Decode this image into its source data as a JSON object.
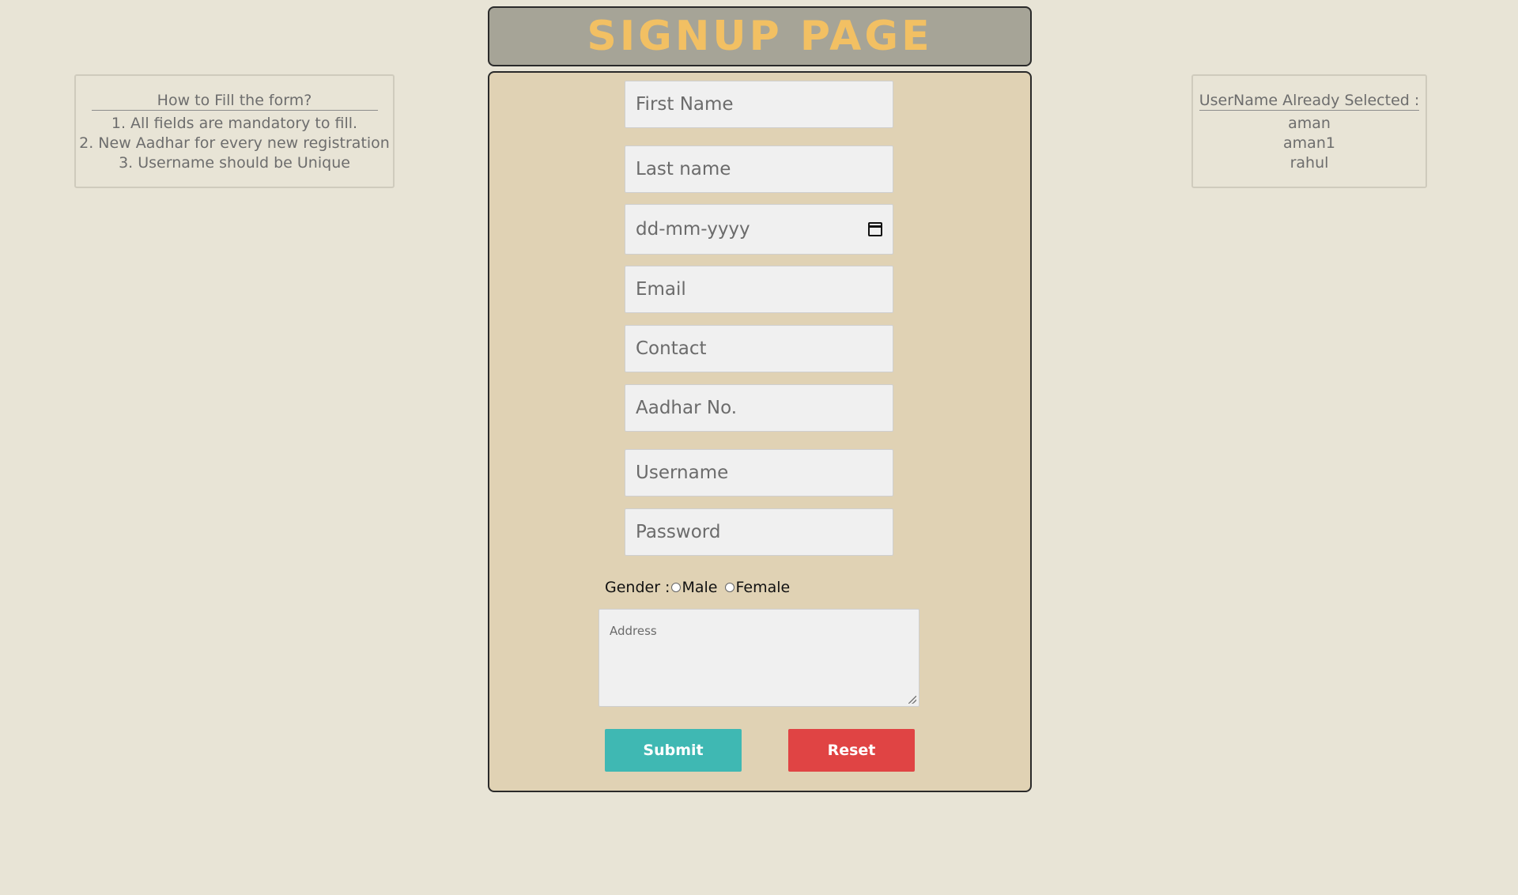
{
  "header": {
    "title": "SIGNUP PAGE"
  },
  "instructions": {
    "title": "How to Fill the form?",
    "items": [
      "1. All fields are mandatory to fill.",
      "2. New Aadhar for every new registration",
      "3. Username should be Unique"
    ]
  },
  "taken_usernames": {
    "title": "UserName Already Selected :",
    "items": [
      "aman",
      "aman1",
      "rahul"
    ]
  },
  "form": {
    "first_name_placeholder": "First Name",
    "last_name_placeholder": "Last name",
    "dob_placeholder": "dd-mm-yyyy",
    "email_placeholder": "Email",
    "contact_placeholder": "Contact",
    "aadhar_placeholder": "Aadhar No.",
    "username_placeholder": "Username",
    "password_placeholder": "Password",
    "gender_label": "Gender :",
    "gender_options": [
      "Male",
      "Female"
    ],
    "address_placeholder": "Address",
    "submit_label": "Submit",
    "reset_label": "Reset"
  },
  "colors": {
    "page_bg": "#e8e4d6",
    "header_bg": "#a6a497",
    "title_color": "#f2c063",
    "form_bg": "#e0d2b4",
    "submit_bg": "#3fb8b3",
    "reset_bg": "#e04444"
  }
}
